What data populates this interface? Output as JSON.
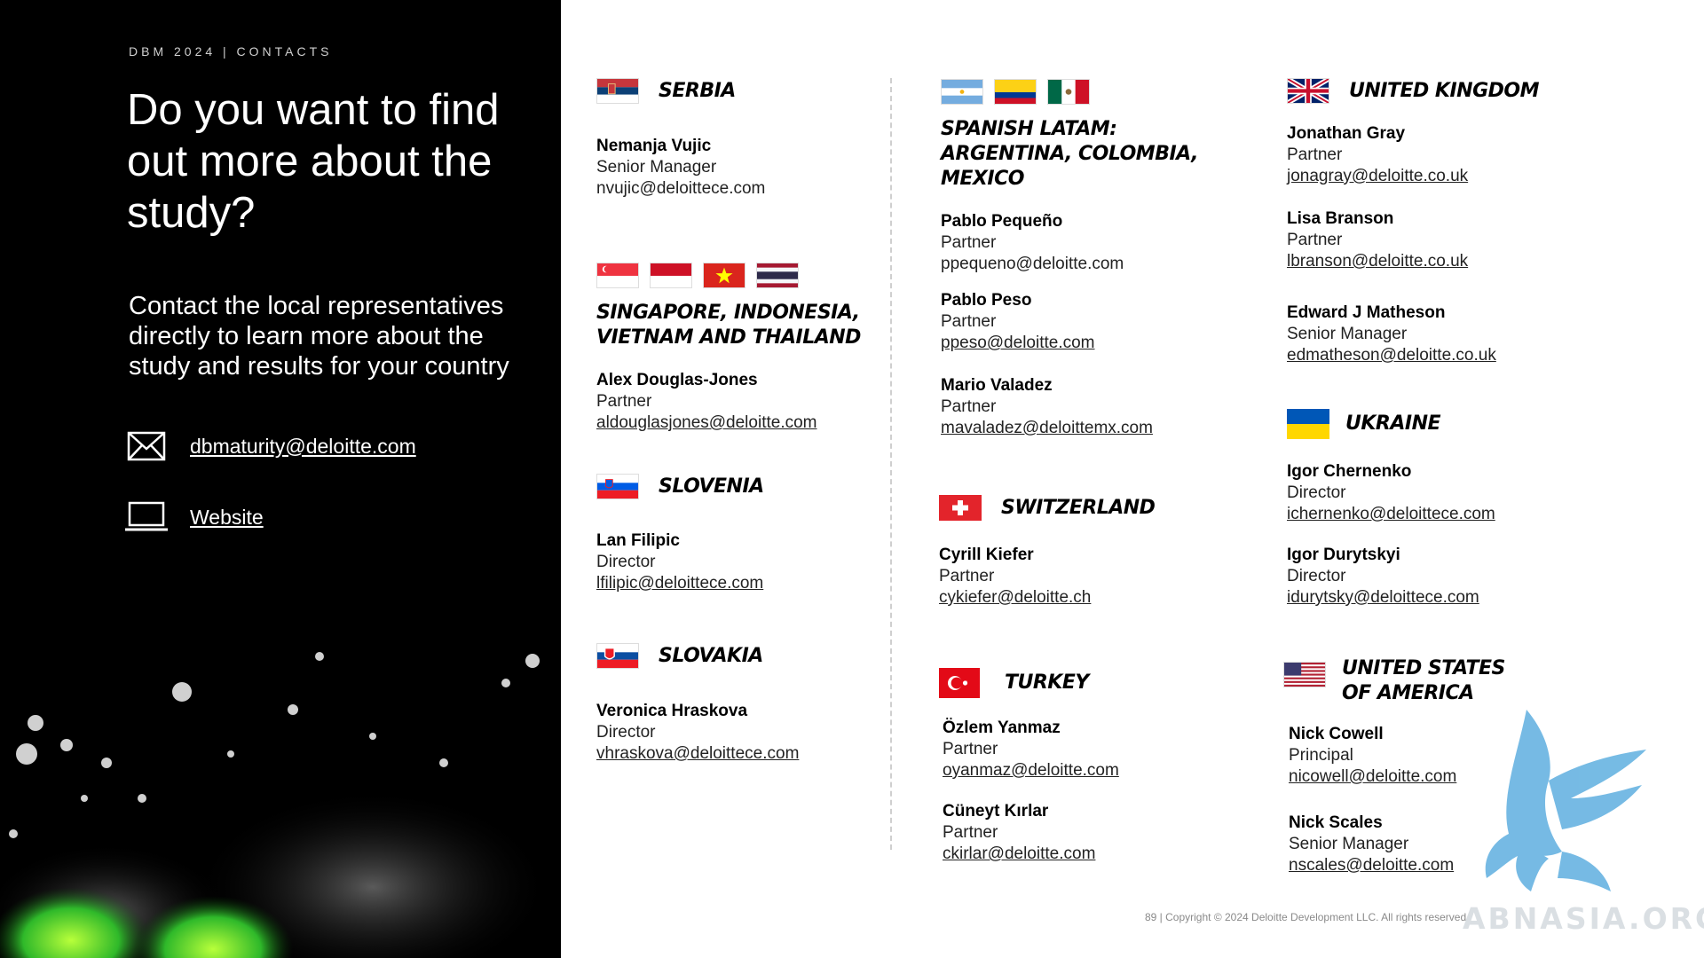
{
  "header": {
    "kicker": "DBM 2024 | CONTACTS"
  },
  "hero": {
    "title": "Do you want to find out more about the study?",
    "subtitle": "Contact the local representatives directly to learn more about the study and results for your country"
  },
  "contact_links": {
    "email": "dbmaturity@deloitte.com",
    "website": "Website"
  },
  "countries": {
    "serbia": {
      "title": "SERBIA",
      "people": [
        {
          "name": "Nemanja Vujic",
          "role": "Senior Manager",
          "email": "nvujic@deloittece.com"
        }
      ]
    },
    "sea": {
      "title": "SINGAPORE, INDONESIA, VIETNAM AND THAILAND",
      "people": [
        {
          "name": "Alex Douglas-Jones",
          "role": "Partner",
          "email": "aldouglasjones@deloitte.com"
        }
      ]
    },
    "slovenia": {
      "title": "SLOVENIA",
      "people": [
        {
          "name": "Lan Filipic",
          "role": "Director",
          "email": "lfilipic@deloittece.com"
        }
      ]
    },
    "slovakia": {
      "title": "SLOVAKIA",
      "people": [
        {
          "name": "Veronica Hraskova",
          "role": "Director",
          "email": "vhraskova@deloittece.com"
        }
      ]
    },
    "latam": {
      "title": "SPANISH LATAM: ARGENTINA, COLOMBIA, MEXICO",
      "people": [
        {
          "name": "Pablo Pequeño",
          "role": "Partner",
          "email": "ppequeno@deloitte.com"
        },
        {
          "name": "Pablo Peso",
          "role": "Partner",
          "email": "ppeso@deloitte.com"
        },
        {
          "name": "Mario Valadez",
          "role": "Partner",
          "email": "mavaladez@deloittemx.com"
        }
      ]
    },
    "switzerland": {
      "title": "SWITZERLAND",
      "people": [
        {
          "name": "Cyrill Kiefer",
          "role": "Partner",
          "email": "cykiefer@deloitte.ch"
        }
      ]
    },
    "turkey": {
      "title": "TURKEY",
      "people": [
        {
          "name": "Özlem Yanmaz",
          "role": "Partner",
          "email": "oyanmaz@deloitte.com"
        },
        {
          "name": "Cüneyt Kırlar",
          "role": "Partner",
          "email": "ckirlar@deloitte.com"
        }
      ]
    },
    "uk": {
      "title": "UNITED KINGDOM",
      "people": [
        {
          "name": "Jonathan Gray",
          "role": "Partner",
          "email": "jonagray@deloitte.co.uk"
        },
        {
          "name": "Lisa Branson",
          "role": "Partner",
          "email": "lbranson@deloitte.co.uk"
        },
        {
          "name": "Edward J Matheson",
          "role": "Senior Manager",
          "email": "edmatheson@deloitte.co.uk"
        }
      ]
    },
    "ukraine": {
      "title": "UKRAINE",
      "people": [
        {
          "name": "Igor Chernenko",
          "role": "Director",
          "email": "ichernenko@deloittece.com"
        },
        {
          "name": "Igor Durytskyi",
          "role": "Director",
          "email": "idurytsky@deloittece.com"
        }
      ]
    },
    "usa": {
      "title": "UNITED STATES OF AMERICA",
      "people": [
        {
          "name": "Nick Cowell",
          "role": "Principal",
          "email": "nicowell@deloitte.com"
        },
        {
          "name": "Nick Scales",
          "role": "Senior Manager",
          "email": "nscales@deloitte.com"
        }
      ]
    }
  },
  "footer": {
    "text": "89 | Copyright © 2024 Deloitte Development LLC. All rights reserved."
  },
  "watermark": {
    "text": "ABNASIA.ORG"
  },
  "colors": {
    "left_panel": "#000000",
    "watermark_blue": "#6fb7e3",
    "accent_green": "#3ddc3a"
  }
}
